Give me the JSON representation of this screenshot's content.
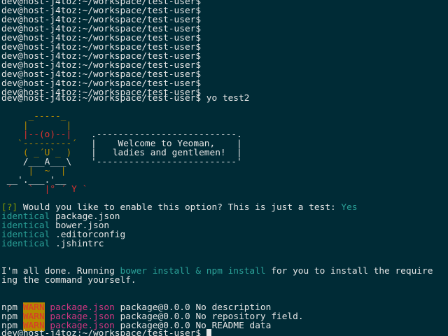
{
  "terminal": {
    "prompt": "dev@host-j4toz:~/workspace/test-user$",
    "command": "yo test2",
    "yeoman": {
      "art": [
        "     _-----_",
        "    |       |",
        "    |--(o)--|",
        "   `---------´",
        "    ( _´U`_ )",
        "    /___A___\\",
        "     |  ~  |",
        " __'.___.'__",
        " ´   `  |° ´ Y `"
      ],
      "box_top": ".--------------------------.",
      "box_line1": "|    Welcome to Yeoman,    |",
      "box_line2": "|   ladies and gentlemen!  |",
      "box_bottom": "'--------------------------'"
    },
    "question": {
      "marker": "[?]",
      "text": "Would you like to enable this option? This is just a test:",
      "answer": "Yes"
    },
    "identical": {
      "label": "identical",
      "files": [
        "package.json",
        "bower.json",
        ".editorconfig",
        ".jshintrc"
      ]
    },
    "done": {
      "prefix": "I'm all done. Running",
      "cmd": "bower install & npm install",
      "suffix": "for you to install the require",
      "line2": "ing the command yourself."
    },
    "npm": {
      "tool": "npm",
      "level": "WARN",
      "file": "package.json",
      "pkg": "package@0.0.0",
      "messages": [
        "No description",
        "No repository field.",
        "No README data"
      ]
    }
  }
}
